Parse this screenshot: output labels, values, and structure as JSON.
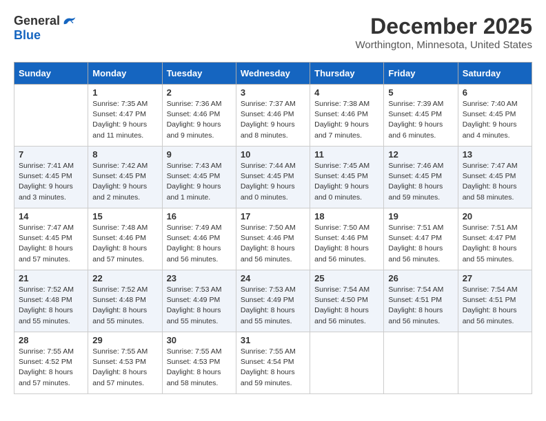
{
  "logo": {
    "general": "General",
    "blue": "Blue"
  },
  "title": "December 2025",
  "location": "Worthington, Minnesota, United States",
  "days_header": [
    "Sunday",
    "Monday",
    "Tuesday",
    "Wednesday",
    "Thursday",
    "Friday",
    "Saturday"
  ],
  "weeks": [
    [
      {
        "day": "",
        "sunrise": "",
        "sunset": "",
        "daylight": ""
      },
      {
        "day": "1",
        "sunrise": "Sunrise: 7:35 AM",
        "sunset": "Sunset: 4:47 PM",
        "daylight": "Daylight: 9 hours and 11 minutes."
      },
      {
        "day": "2",
        "sunrise": "Sunrise: 7:36 AM",
        "sunset": "Sunset: 4:46 PM",
        "daylight": "Daylight: 9 hours and 9 minutes."
      },
      {
        "day": "3",
        "sunrise": "Sunrise: 7:37 AM",
        "sunset": "Sunset: 4:46 PM",
        "daylight": "Daylight: 9 hours and 8 minutes."
      },
      {
        "day": "4",
        "sunrise": "Sunrise: 7:38 AM",
        "sunset": "Sunset: 4:46 PM",
        "daylight": "Daylight: 9 hours and 7 minutes."
      },
      {
        "day": "5",
        "sunrise": "Sunrise: 7:39 AM",
        "sunset": "Sunset: 4:45 PM",
        "daylight": "Daylight: 9 hours and 6 minutes."
      },
      {
        "day": "6",
        "sunrise": "Sunrise: 7:40 AM",
        "sunset": "Sunset: 4:45 PM",
        "daylight": "Daylight: 9 hours and 4 minutes."
      }
    ],
    [
      {
        "day": "7",
        "sunrise": "Sunrise: 7:41 AM",
        "sunset": "Sunset: 4:45 PM",
        "daylight": "Daylight: 9 hours and 3 minutes."
      },
      {
        "day": "8",
        "sunrise": "Sunrise: 7:42 AM",
        "sunset": "Sunset: 4:45 PM",
        "daylight": "Daylight: 9 hours and 2 minutes."
      },
      {
        "day": "9",
        "sunrise": "Sunrise: 7:43 AM",
        "sunset": "Sunset: 4:45 PM",
        "daylight": "Daylight: 9 hours and 1 minute."
      },
      {
        "day": "10",
        "sunrise": "Sunrise: 7:44 AM",
        "sunset": "Sunset: 4:45 PM",
        "daylight": "Daylight: 9 hours and 0 minutes."
      },
      {
        "day": "11",
        "sunrise": "Sunrise: 7:45 AM",
        "sunset": "Sunset: 4:45 PM",
        "daylight": "Daylight: 9 hours and 0 minutes."
      },
      {
        "day": "12",
        "sunrise": "Sunrise: 7:46 AM",
        "sunset": "Sunset: 4:45 PM",
        "daylight": "Daylight: 8 hours and 59 minutes."
      },
      {
        "day": "13",
        "sunrise": "Sunrise: 7:47 AM",
        "sunset": "Sunset: 4:45 PM",
        "daylight": "Daylight: 8 hours and 58 minutes."
      }
    ],
    [
      {
        "day": "14",
        "sunrise": "Sunrise: 7:47 AM",
        "sunset": "Sunset: 4:45 PM",
        "daylight": "Daylight: 8 hours and 57 minutes."
      },
      {
        "day": "15",
        "sunrise": "Sunrise: 7:48 AM",
        "sunset": "Sunset: 4:46 PM",
        "daylight": "Daylight: 8 hours and 57 minutes."
      },
      {
        "day": "16",
        "sunrise": "Sunrise: 7:49 AM",
        "sunset": "Sunset: 4:46 PM",
        "daylight": "Daylight: 8 hours and 56 minutes."
      },
      {
        "day": "17",
        "sunrise": "Sunrise: 7:50 AM",
        "sunset": "Sunset: 4:46 PM",
        "daylight": "Daylight: 8 hours and 56 minutes."
      },
      {
        "day": "18",
        "sunrise": "Sunrise: 7:50 AM",
        "sunset": "Sunset: 4:46 PM",
        "daylight": "Daylight: 8 hours and 56 minutes."
      },
      {
        "day": "19",
        "sunrise": "Sunrise: 7:51 AM",
        "sunset": "Sunset: 4:47 PM",
        "daylight": "Daylight: 8 hours and 56 minutes."
      },
      {
        "day": "20",
        "sunrise": "Sunrise: 7:51 AM",
        "sunset": "Sunset: 4:47 PM",
        "daylight": "Daylight: 8 hours and 55 minutes."
      }
    ],
    [
      {
        "day": "21",
        "sunrise": "Sunrise: 7:52 AM",
        "sunset": "Sunset: 4:48 PM",
        "daylight": "Daylight: 8 hours and 55 minutes."
      },
      {
        "day": "22",
        "sunrise": "Sunrise: 7:52 AM",
        "sunset": "Sunset: 4:48 PM",
        "daylight": "Daylight: 8 hours and 55 minutes."
      },
      {
        "day": "23",
        "sunrise": "Sunrise: 7:53 AM",
        "sunset": "Sunset: 4:49 PM",
        "daylight": "Daylight: 8 hours and 55 minutes."
      },
      {
        "day": "24",
        "sunrise": "Sunrise: 7:53 AM",
        "sunset": "Sunset: 4:49 PM",
        "daylight": "Daylight: 8 hours and 55 minutes."
      },
      {
        "day": "25",
        "sunrise": "Sunrise: 7:54 AM",
        "sunset": "Sunset: 4:50 PM",
        "daylight": "Daylight: 8 hours and 56 minutes."
      },
      {
        "day": "26",
        "sunrise": "Sunrise: 7:54 AM",
        "sunset": "Sunset: 4:51 PM",
        "daylight": "Daylight: 8 hours and 56 minutes."
      },
      {
        "day": "27",
        "sunrise": "Sunrise: 7:54 AM",
        "sunset": "Sunset: 4:51 PM",
        "daylight": "Daylight: 8 hours and 56 minutes."
      }
    ],
    [
      {
        "day": "28",
        "sunrise": "Sunrise: 7:55 AM",
        "sunset": "Sunset: 4:52 PM",
        "daylight": "Daylight: 8 hours and 57 minutes."
      },
      {
        "day": "29",
        "sunrise": "Sunrise: 7:55 AM",
        "sunset": "Sunset: 4:53 PM",
        "daylight": "Daylight: 8 hours and 57 minutes."
      },
      {
        "day": "30",
        "sunrise": "Sunrise: 7:55 AM",
        "sunset": "Sunset: 4:53 PM",
        "daylight": "Daylight: 8 hours and 58 minutes."
      },
      {
        "day": "31",
        "sunrise": "Sunrise: 7:55 AM",
        "sunset": "Sunset: 4:54 PM",
        "daylight": "Daylight: 8 hours and 59 minutes."
      },
      {
        "day": "",
        "sunrise": "",
        "sunset": "",
        "daylight": ""
      },
      {
        "day": "",
        "sunrise": "",
        "sunset": "",
        "daylight": ""
      },
      {
        "day": "",
        "sunrise": "",
        "sunset": "",
        "daylight": ""
      }
    ]
  ]
}
